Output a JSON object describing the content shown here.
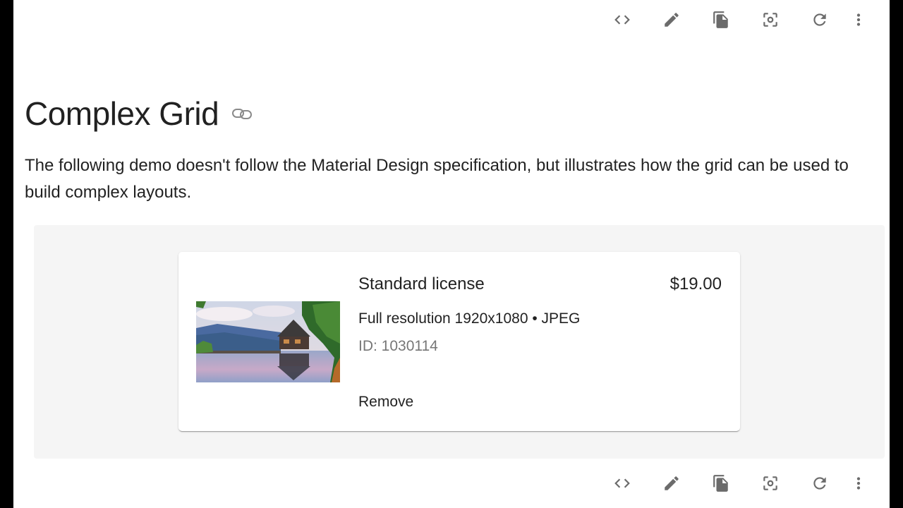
{
  "toolbar_top": {
    "icons": [
      "code-icon",
      "edit-pencil-icon",
      "copy-file-icon",
      "screenshot-focus-icon",
      "refresh-icon",
      "more-vert-icon"
    ]
  },
  "heading": {
    "title": "Complex Grid",
    "link_icon": "link-icon"
  },
  "description": "The following demo doesn't follow the Material Design specification, but illustrates how the grid can be used to build complex layouts.",
  "demo": {
    "card": {
      "image_alt": "lake house landscape",
      "title": "Standard license",
      "price": "$19.00",
      "resolution": "Full resolution 1920x1080 • JPEG",
      "id": "ID: 1030114",
      "remove_label": "Remove"
    },
    "background_color": "#f5f5f5"
  },
  "toolbar_bottom": {
    "icons": [
      "code-icon",
      "edit-pencil-icon",
      "copy-file-icon",
      "screenshot-focus-icon",
      "refresh-icon",
      "more-vert-icon"
    ]
  }
}
